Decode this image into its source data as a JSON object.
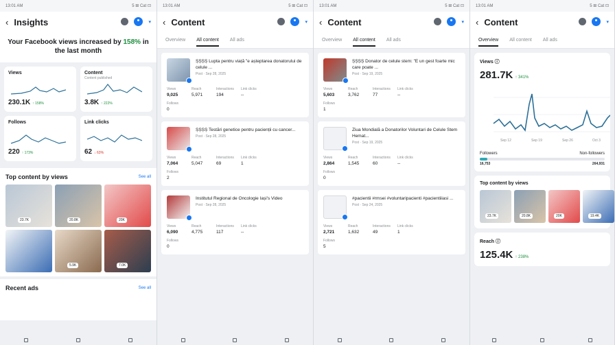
{
  "status": {
    "time": "13:01 AM",
    "signal": "5 ⊞ Cat ⊡"
  },
  "insights": {
    "title": "Insights",
    "headline_pre": "Your Facebook views increased by ",
    "headline_pct": "158%",
    "headline_post": " in the last month",
    "cards": [
      {
        "label": "Views",
        "sub": "",
        "value": "230.1K",
        "delta": "↑ 158%",
        "dir": "up"
      },
      {
        "label": "Content",
        "sub": "Content published",
        "value": "3.8K",
        "delta": "↑ 222%",
        "dir": "up"
      },
      {
        "label": "Follows",
        "sub": "",
        "value": "220",
        "delta": "↑ 173%",
        "dir": "up"
      },
      {
        "label": "Link clicks",
        "sub": "",
        "value": "62",
        "delta": "↓ 63%",
        "dir": "down"
      }
    ],
    "top_title": "Top content by views",
    "see_all": "See all",
    "top_thumbs": [
      "23.7K",
      "20.8K",
      "20K",
      "",
      "5.9K",
      "7.0K"
    ],
    "recent_title": "Recent ads",
    "recent_see_all": "See all"
  },
  "content": {
    "title": "Content",
    "tabs": [
      "Overview",
      "All content",
      "All ads"
    ],
    "stat_labels": [
      "Views",
      "Reach",
      "Interactions",
      "Link clicks"
    ],
    "follows_label": "Follows",
    "col1": [
      {
        "title": "Ș‍Ș‍Ș‍Ș Lupta pentru viață \"e așteptarea donatorului de celule ...",
        "date": "Post · Sep 28, 2025",
        "views": "9,025",
        "reach": "5,971",
        "inter": "194",
        "links": "--",
        "follows": "0"
      },
      {
        "title": "Ș‍Ș‍Ș‍Ș Testări genetice pentru pacienții cu cancer...",
        "date": "Post · Sep 28, 2025",
        "views": "7,064",
        "reach": "5,047",
        "inter": "69",
        "links": "1",
        "follows": "2"
      },
      {
        "title": "Institutul Regional de Oncologie Iași's Video",
        "date": "Post · Sep 28, 2025",
        "views": "6,090",
        "reach": "4,775",
        "inter": "117",
        "links": "--",
        "follows": "0"
      }
    ],
    "col2": [
      {
        "title": "Ș‍Ș‍Ș‍Ș Donator de celule stem: \"E un gest foarte mic care poate ...",
        "date": "Post · Sep 19, 2025",
        "views": "5,603",
        "reach": "3,762",
        "inter": "77",
        "links": "--",
        "follows": "1"
      },
      {
        "title": "Ziua Mondială a Donatorilor Voluntari de Celule Stem Hemat...",
        "date": "Post · Sep 19, 2025",
        "views": "2,864",
        "reach": "1,545",
        "inter": "60",
        "links": "--",
        "follows": "0"
      },
      {
        "title": "#pacientii #rmsei #voluntaripacienti #pacientiiiasi ...",
        "date": "Post · Sep 24, 2025",
        "views": "2,721",
        "reach": "1,632",
        "inter": "49",
        "links": "1",
        "follows": "5"
      }
    ]
  },
  "overview": {
    "views_label": "Views ⓘ",
    "views_value": "281.7K",
    "views_delta": "↑ 341%",
    "axis": [
      "Sep 12",
      "Sep 19",
      "Sep 26",
      "Oct 3"
    ],
    "followers_label": "Followers",
    "non_followers_label": "Non-followers",
    "followers_value": "16,753",
    "non_followers_value": "264,931",
    "followers_share": 0.06,
    "top_title": "Top content by views",
    "top_thumbs": [
      "23.7K",
      "20.8K",
      "20K",
      "19.4K"
    ],
    "reach_label": "Reach ⓘ",
    "reach_value": "125.4K",
    "reach_delta": "↑ 238%"
  },
  "colors": {
    "accent": "#1877f2",
    "positive": "#1e8e3e",
    "teal": "#2ea8b5"
  }
}
